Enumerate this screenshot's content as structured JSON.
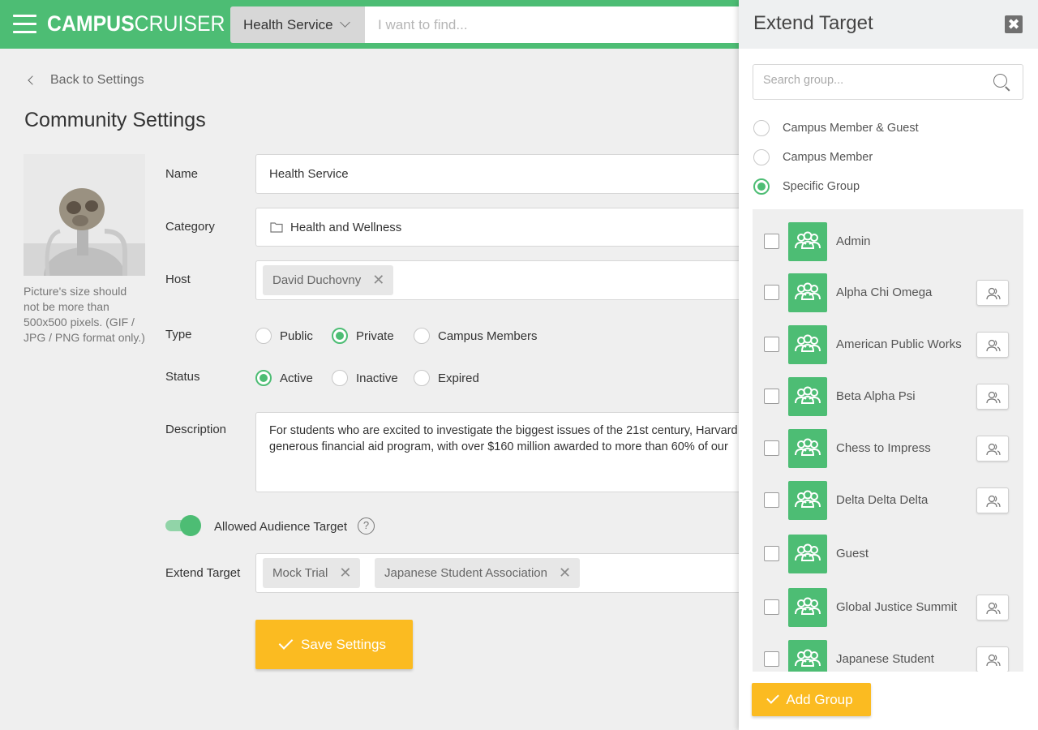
{
  "header": {
    "brand_bold": "CAMPUS",
    "brand_light": "CRUISER",
    "community_select": "Health Service",
    "search_placeholder": "I want to find..."
  },
  "main": {
    "back_link": "Back to Settings",
    "page_title": "Community Settings",
    "picture_note": "Picture's size should not be more than 500x500 pixels. (GIF / JPG / PNG format only.)",
    "name": {
      "label": "Name",
      "value": "Health Service"
    },
    "category": {
      "label": "Category",
      "value": "Health and Wellness"
    },
    "host": {
      "label": "Host",
      "tags": [
        "David Duchovny"
      ]
    },
    "type": {
      "label": "Type",
      "options": [
        "Public",
        "Private",
        "Campus Members"
      ],
      "selected": "Private"
    },
    "status": {
      "label": "Status",
      "options": [
        "Active",
        "Inactive",
        "Expired"
      ],
      "selected": "Active"
    },
    "description": {
      "label": "Description",
      "line1": "For students who are excited to investigate the biggest issues of the 21st century, Harvard",
      "line2": "generous financial aid program, with over $160 million awarded to more than 60% of our"
    },
    "audience_toggle": {
      "label": "Allowed Audience Target",
      "on": true,
      "help": "?"
    },
    "extend_target": {
      "label": "Extend Target",
      "tags": [
        "Mock Trial",
        "Japanese Student Association"
      ]
    },
    "save_button": "Save Settings"
  },
  "panel": {
    "title": "Extend Target",
    "close": "✖",
    "search_placeholder": "Search group...",
    "audience_options": [
      "Campus Member & Guest",
      "Campus Member",
      "Specific Group"
    ],
    "audience_selected": "Specific Group",
    "groups": [
      {
        "name": "Admin",
        "has_action": false
      },
      {
        "name": "Alpha Chi Omega",
        "has_action": true
      },
      {
        "name": "American Public Works",
        "has_action": true
      },
      {
        "name": "Beta Alpha Psi",
        "has_action": true
      },
      {
        "name": "Chess to Impress",
        "has_action": true
      },
      {
        "name": "Delta Delta Delta",
        "has_action": true
      },
      {
        "name": "Guest",
        "has_action": false
      },
      {
        "name": "Global Justice Summit",
        "has_action": true
      },
      {
        "name": "Japanese Student",
        "has_action": true
      }
    ],
    "add_button": "Add Group"
  },
  "colors": {
    "brand_green": "#4dbd74",
    "accent_yellow": "#fbbb21"
  }
}
